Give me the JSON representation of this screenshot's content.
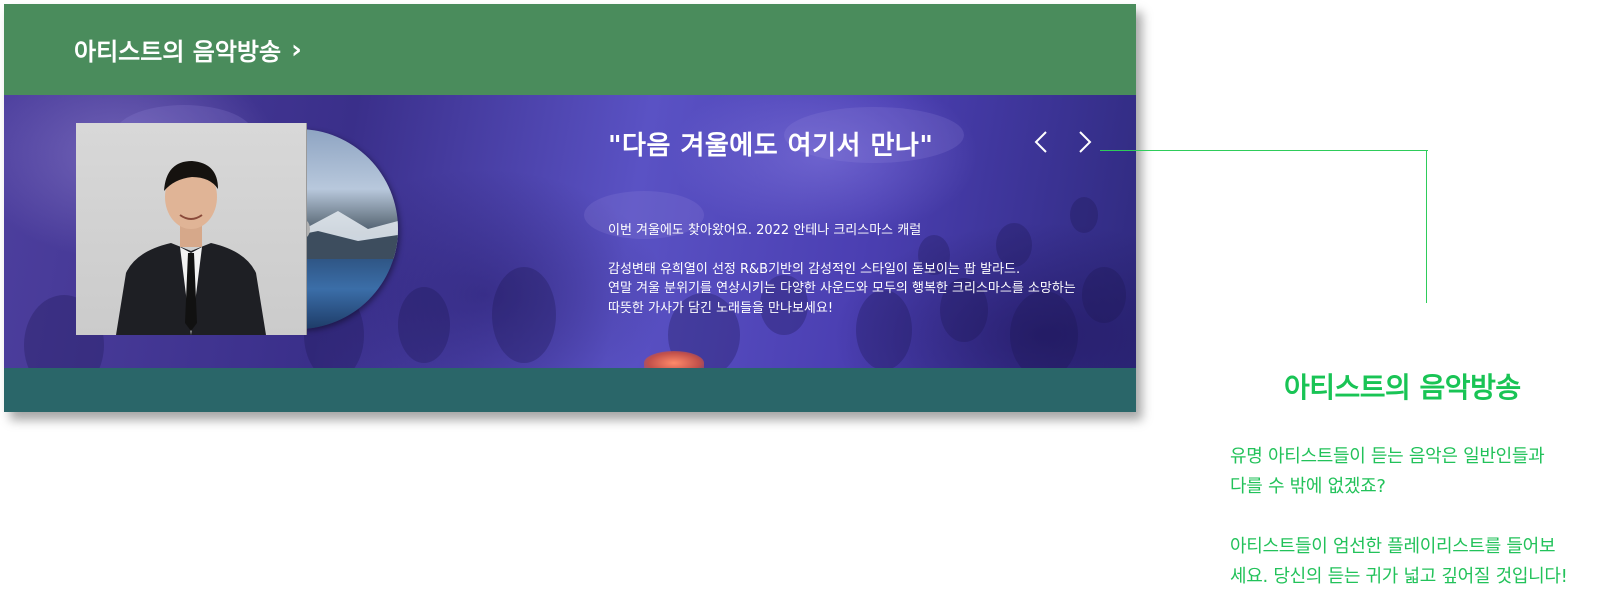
{
  "card": {
    "title": "아티스트의 음악방송",
    "title_chevron": "›",
    "colors": {
      "header": "#4a8c5c",
      "footer": "#2a6669",
      "banner": "#4d3f9e"
    }
  },
  "banner": {
    "quote": "\"다음 겨울에도 여기서 만나\"",
    "prev_icon": "chevron-left-icon",
    "next_icon": "chevron-right-icon",
    "intro": "이번 겨울에도 찾아왔어요. 2022 안테나 크리스마스 캐럴",
    "desc_line1": "감성변태 유희열이 선정 R&B기반의 감성적인 스타일이 돋보이는 팝 발라드.",
    "desc_line2": "연말 겨울 분위기를 연상시키는 다양한 사운드와 모두의 행복한 크리스마스를 소망하는",
    "desc_line3": "따뜻한 가사가 담긴 노래들을 만나보세요!"
  },
  "annotation": {
    "title": "아티스트의 음악방송",
    "para1_line1": "유명 아티스트들이 듣는 음악은 일반인들과",
    "para1_line2": "다를 수 밖에 없겠죠?",
    "para2_line1": "아티스트들이 엄선한 플레이리스트를 들어보",
    "para2_line2": "세요. 당신의 듣는 귀가 넓고 깊어질 것입니다!",
    "accent_color": "#19c455"
  }
}
